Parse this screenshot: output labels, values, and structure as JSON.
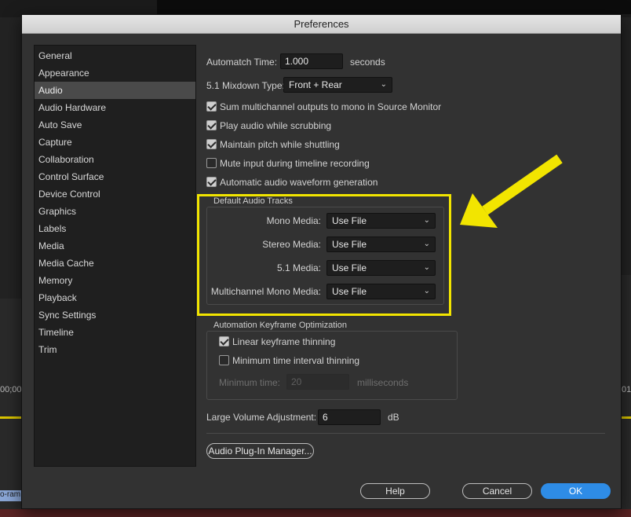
{
  "window": {
    "title": "Preferences"
  },
  "sidebar": {
    "items": [
      {
        "label": "General"
      },
      {
        "label": "Appearance"
      },
      {
        "label": "Audio",
        "selected": true
      },
      {
        "label": "Audio Hardware"
      },
      {
        "label": "Auto Save"
      },
      {
        "label": "Capture"
      },
      {
        "label": "Collaboration"
      },
      {
        "label": "Control Surface"
      },
      {
        "label": "Device Control"
      },
      {
        "label": "Graphics"
      },
      {
        "label": "Labels"
      },
      {
        "label": "Media"
      },
      {
        "label": "Media Cache"
      },
      {
        "label": "Memory"
      },
      {
        "label": "Playback"
      },
      {
        "label": "Sync Settings"
      },
      {
        "label": "Timeline"
      },
      {
        "label": "Trim"
      }
    ]
  },
  "audio": {
    "automatch": {
      "label": "Automatch Time:",
      "value": "1.000",
      "unit": "seconds"
    },
    "mixdown": {
      "label": "5.1 Mixdown Type:",
      "value": "Front + Rear"
    },
    "checkboxes": [
      {
        "label": "Sum multichannel outputs to mono in Source Monitor",
        "checked": true
      },
      {
        "label": "Play audio while scrubbing",
        "checked": true
      },
      {
        "label": "Maintain pitch while shuttling",
        "checked": true
      },
      {
        "label": "Mute input during timeline recording",
        "checked": false
      },
      {
        "label": "Automatic audio waveform generation",
        "checked": true
      }
    ],
    "default_tracks": {
      "title": "Default Audio Tracks",
      "rows": [
        {
          "label": "Mono Media:",
          "value": "Use File"
        },
        {
          "label": "Stereo Media:",
          "value": "Use File"
        },
        {
          "label": "5.1 Media:",
          "value": "Use File"
        },
        {
          "label": "Multichannel Mono Media:",
          "value": "Use File"
        }
      ]
    },
    "keyframe_opt": {
      "title": "Automation Keyframe Optimization",
      "linear": {
        "label": "Linear keyframe thinning",
        "checked": true
      },
      "min_interval": {
        "label": "Minimum time interval thinning",
        "checked": false
      },
      "min_time": {
        "label": "Minimum time:",
        "value": "20",
        "unit": "milliseconds"
      }
    },
    "large_volume": {
      "label": "Large Volume Adjustment:",
      "value": "6",
      "unit": "dB"
    },
    "plugin_button": "Audio Plug-In Manager..."
  },
  "footer": {
    "help": "Help",
    "cancel": "Cancel",
    "ok": "OK"
  },
  "background": {
    "ruler_left": "00;00",
    "ruler_right": "01",
    "clip_label": "o-ram"
  },
  "colors": {
    "highlight": "#f2e500",
    "accent": "#2e8ce6"
  }
}
